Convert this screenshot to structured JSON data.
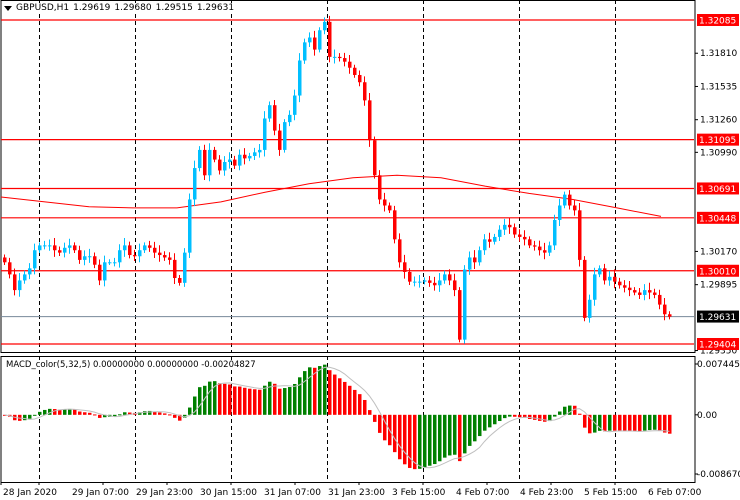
{
  "header": {
    "symbol": "GBPUSD,H1",
    "open": "1.29619",
    "high": "1.29680",
    "low": "1.29515",
    "close": "1.29631"
  },
  "macd_header": {
    "label": "MACD_color(5,32,5)",
    "v1": "0.00000000",
    "v2": "0.00000000",
    "v3": "-0.00204827"
  },
  "colors": {
    "bull": "#00BFFF",
    "bear": "#FF0000",
    "level": "#FF0000",
    "current": "#778899",
    "macd_up": "#008000",
    "macd_down": "#FF0000",
    "signal": "#C0C0C0"
  },
  "chart_data": {
    "type": "candlestick",
    "symbol": "GBPUSD",
    "timeframe": "H1",
    "ylim": [
      1.2935,
      1.3211
    ],
    "closes": [
      1.3008,
      1.2998,
      1.2985,
      1.2993,
      1.2998,
      1.3003,
      1.3018,
      1.3022,
      1.3022,
      1.3022,
      1.3018,
      1.3016,
      1.302,
      1.3022,
      1.3018,
      1.301,
      1.3013,
      1.3013,
      1.3006,
      1.2993,
      1.3008,
      1.3008,
      1.3008,
      1.3018,
      1.3022,
      1.3014,
      1.3013,
      1.3018,
      1.3022,
      1.302,
      1.3016,
      1.3014,
      1.3012,
      1.301,
      1.2995,
      1.2991,
      1.3016,
      1.306,
      1.3086,
      1.3101,
      1.308,
      1.3101,
      1.3093,
      1.3084,
      1.3091,
      1.3093,
      1.3088,
      1.3097,
      1.3094,
      1.3096,
      1.3099,
      1.3101,
      1.3127,
      1.3138,
      1.3117,
      1.3101,
      1.3124,
      1.313,
      1.3146,
      1.3175,
      1.319,
      1.3194,
      1.3184,
      1.32,
      1.3207,
      1.3178,
      1.3178,
      1.3177,
      1.3174,
      1.3169,
      1.3163,
      1.3157,
      1.3142,
      1.3109,
      1.308,
      1.306,
      1.3055,
      1.3051,
      1.3027,
      1.3008,
      1.3,
      1.2992,
      1.2992,
      1.2992,
      1.2993,
      1.2991,
      1.2989,
      1.2993,
      1.2998,
      1.2993,
      1.2985,
      1.2944,
      1.3002,
      1.3012,
      1.3008,
      1.3018,
      1.3027,
      1.3025,
      1.3029,
      1.3035,
      1.3039,
      1.3037,
      1.3031,
      1.3029,
      1.3027,
      1.3022,
      1.3021,
      1.3018,
      1.3016,
      1.3022,
      1.3043,
      1.3055,
      1.3064,
      1.3055,
      1.3051,
      1.301,
      1.2962,
      1.2977,
      1.2998,
      1.3003,
      1.2993,
      1.2996,
      1.2992,
      1.2989,
      1.2987,
      1.2985,
      1.2983,
      1.2981,
      1.2985,
      1.2983,
      1.2981,
      1.2973,
      1.2965,
      1.2963
    ],
    "moving_average": [
      1.3062,
      1.3058,
      1.3054,
      1.3053,
      1.3053,
      1.3058,
      1.3066,
      1.3073,
      1.3078,
      1.308,
      1.3078,
      1.3071,
      1.3065,
      1.306,
      1.3053,
      1.3046
    ],
    "levels": [
      {
        "price": 1.32085,
        "label": "1.32085"
      },
      {
        "price": 1.31095,
        "label": "1.31095"
      },
      {
        "price": 1.30691,
        "label": "1.30691"
      },
      {
        "price": 1.30448,
        "label": "1.30448"
      },
      {
        "price": 1.3001,
        "label": "1.30010"
      },
      {
        "price": 1.29404,
        "label": "1.29404"
      }
    ],
    "current_price": {
      "price": 1.29631,
      "label": "1.29631"
    },
    "price_ticks": [
      {
        "price": 1.3181,
        "label": "1.31810"
      },
      {
        "price": 1.31535,
        "label": "1.31535"
      },
      {
        "price": 1.3126,
        "label": "1.31260"
      },
      {
        "price": 1.3099,
        "label": "1.30990"
      },
      {
        "price": 1.3017,
        "label": "1.30170"
      },
      {
        "price": 1.29895,
        "label": "1.29895"
      },
      {
        "price": 1.2935,
        "label": "1.29350"
      }
    ],
    "macd_ticks": [
      {
        "value": 0.0074451,
        "label": "0.0074451"
      },
      {
        "value": 0,
        "label": "0.00"
      },
      {
        "value": -0.00867,
        "label": "-0.008670"
      }
    ],
    "time_labels": [
      "28 Jan 2020",
      "29 Jan 07:00",
      "29 Jan 23:00",
      "30 Jan 15:00",
      "31 Jan 07:00",
      "31 Jan 23:00",
      "3 Feb 15:00",
      "4 Feb 07:00",
      "4 Feb 23:00",
      "5 Feb 15:00",
      "6 Feb 07:00"
    ]
  }
}
